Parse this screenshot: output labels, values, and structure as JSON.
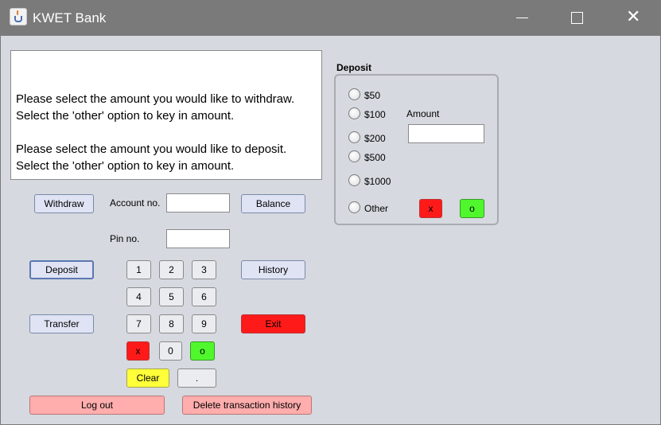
{
  "window": {
    "title": "KWET Bank",
    "minimize_glyph": "",
    "maximize_glyph": "",
    "close_glyph": "✕",
    "icon": "java-cup-icon"
  },
  "message": {
    "line1": "Please select the amount you would like to withdraw.",
    "line2": "Select the 'other' option to key in amount.",
    "line3": "Please select the amount you would like to deposit.",
    "line4": "Select the 'other' option to key in amount."
  },
  "left_buttons": {
    "withdraw": "Withdraw",
    "deposit": "Deposit",
    "transfer": "Transfer",
    "log_out": "Log out"
  },
  "credentials": {
    "account_label": "Account no.",
    "account_value": "",
    "pin_label": "Pin no.",
    "pin_value": ""
  },
  "right_buttons": {
    "balance": "Balance",
    "history": "History",
    "exit": "Exit",
    "delete_history": "Delete transaction history"
  },
  "keypad": {
    "k1": "1",
    "k2": "2",
    "k3": "3",
    "k4": "4",
    "k5": "5",
    "k6": "6",
    "k7": "7",
    "k8": "8",
    "k9": "9",
    "cancel": "x",
    "k0": "0",
    "ok": "o",
    "clear": "Clear",
    "dot": "."
  },
  "deposit_panel": {
    "title": "Deposit",
    "options": [
      "$50",
      "$100",
      "$200",
      "$500",
      "$1000",
      "Other"
    ],
    "amount_label": "Amount",
    "amount_value": "",
    "cancel": "x",
    "ok": "o"
  },
  "colors": {
    "titlebar": "#7a7a7a",
    "background": "#d6d9df",
    "button": "#dfe3f4",
    "red": "#ff1a1a",
    "green": "#4ff72c",
    "yellow": "#ffff3a",
    "pink": "#ffadad"
  }
}
